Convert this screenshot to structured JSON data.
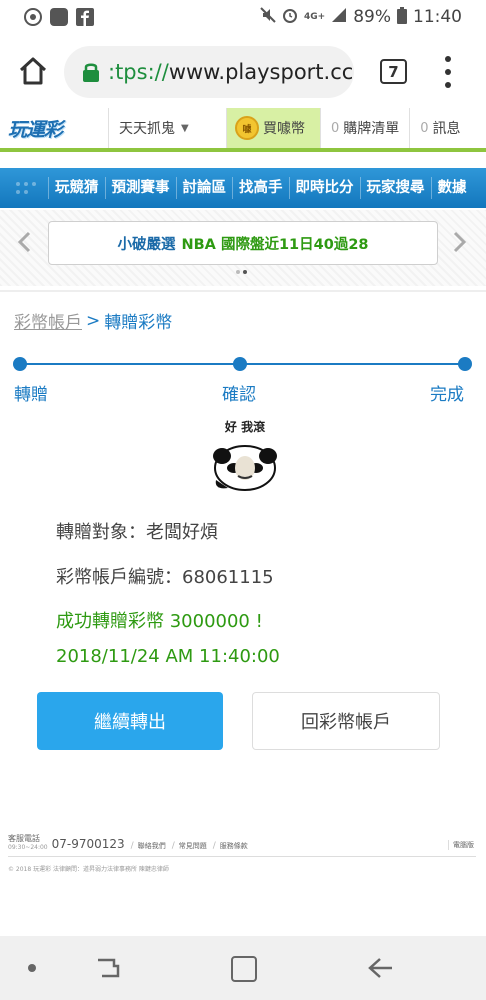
{
  "status_bar": {
    "left_icons": [
      "chrome-icon",
      "line-icon",
      "facebook-icon"
    ],
    "line_label": "LINE",
    "fb_label": "f",
    "network": "4G+",
    "battery": "89%",
    "time": "11:40"
  },
  "browser": {
    "url_scheme": ":tps://",
    "url_rest": "www.playsport.cc",
    "tab_count": "7"
  },
  "site_top": {
    "logo": "玩運彩",
    "catch_ghost": "天天抓鬼",
    "buy_coins": "買噱幣",
    "coin_label": "噱",
    "cart_count": "0",
    "cart_label": "購牌清單",
    "msg_count": "0",
    "msg_label": "訊息"
  },
  "nav": {
    "items": [
      "玩競猜",
      "預測賽事",
      "討論區",
      "找高手",
      "即時比分",
      "玩家搜尋",
      "數據"
    ]
  },
  "announcement": {
    "prefix": "小破嚴選",
    "main": "NBA 國際盤近11日40過28"
  },
  "breadcrumb": {
    "parent": "彩幣帳戶",
    "separator": ">",
    "current": "轉贈彩幣"
  },
  "steps": [
    "轉贈",
    "確認",
    "完成"
  ],
  "sticker": {
    "caption": "好 我滾"
  },
  "result": {
    "recipient": "轉贈對象：老闆好煩",
    "account": "彩幣帳戶編號：68061115",
    "success": "成功轉贈彩幣 3000000 !",
    "timestamp": "2018/11/24 AM 11:40:00"
  },
  "buttons": {
    "continue": "繼續轉出",
    "back_account": "回彩幣帳戶"
  },
  "footer": {
    "phone_label": "客服電話",
    "hours": "09:30~24:00",
    "phone": "07-9700123",
    "links": [
      "聯絡我們",
      "常見問題",
      "服務條款"
    ],
    "right_link": "電腦版",
    "copyright": "© 2018 玩運彩 法律顧問：道昇弱力法律事務所 陳鍵忠律師"
  },
  "colors": {
    "brand_blue": "#1b7bc3",
    "button_blue": "#2aa6ec",
    "success_green": "#2e9a12",
    "accent_lime": "#8ec53f"
  }
}
